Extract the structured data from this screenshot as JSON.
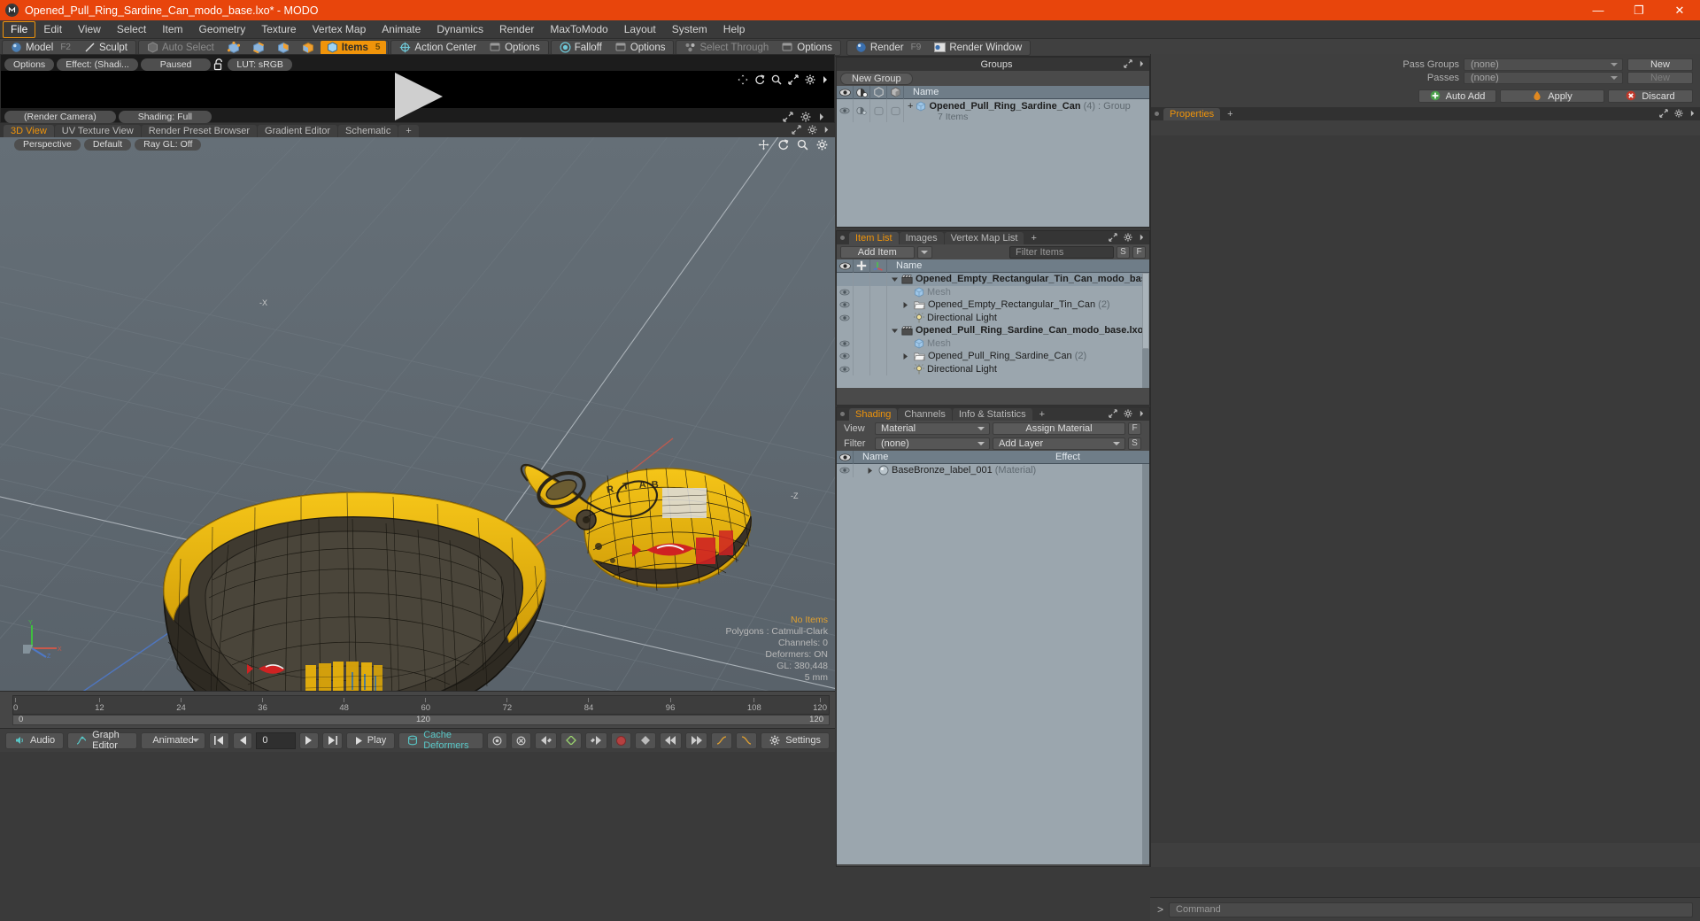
{
  "window": {
    "title": "Opened_Pull_Ring_Sardine_Can_modo_base.lxo* - MODO",
    "logo_glyph": "M",
    "minimize": "—",
    "maximize": "❐",
    "close": "✕",
    "titlebar_color": "#e8450c"
  },
  "menu": {
    "items": [
      {
        "label": "File",
        "active": true
      },
      {
        "label": "Edit",
        "active": false
      },
      {
        "label": "View",
        "active": false
      },
      {
        "label": "Select",
        "active": false
      },
      {
        "label": "Item",
        "active": false
      },
      {
        "label": "Geometry",
        "active": false
      },
      {
        "label": "Texture",
        "active": false
      },
      {
        "label": "Vertex Map",
        "active": false
      },
      {
        "label": "Animate",
        "active": false
      },
      {
        "label": "Dynamics",
        "active": false
      },
      {
        "label": "Render",
        "active": false
      },
      {
        "label": "MaxToModo",
        "active": false
      },
      {
        "label": "Layout",
        "active": false
      },
      {
        "label": "System",
        "active": false
      },
      {
        "label": "Help",
        "active": false
      }
    ]
  },
  "toolbar": {
    "model": "Model",
    "model_key": "F2",
    "sculpt": "Sculpt",
    "auto_select": "Auto Select",
    "items": "Items",
    "items_key": "5",
    "action_center": "Action Center",
    "options_1": "Options",
    "falloff": "Falloff",
    "options_2": "Options",
    "select_through": "Select Through",
    "options_3": "Options",
    "render": "Render",
    "render_key": "F9",
    "render_window": "Render Window",
    "accent": "#f0940a"
  },
  "preview": {
    "options": "Options",
    "effect": "Effect: (Shadi...",
    "paused": "Paused",
    "lock_icon": "unlock-icon",
    "lut": "LUT: sRGB",
    "render_camera": "(Render Camera)",
    "shading": "Shading: Full"
  },
  "viewport_tabs": {
    "tabs": [
      {
        "label": "3D View",
        "active": true
      },
      {
        "label": "UV Texture View",
        "active": false
      },
      {
        "label": "Render Preset Browser",
        "active": false
      },
      {
        "label": "Gradient Editor",
        "active": false
      },
      {
        "label": "Schematic",
        "active": false
      },
      {
        "label": "+",
        "active": false
      }
    ]
  },
  "viewport": {
    "perspective": "Perspective",
    "default": "Default",
    "ray_gl": "Ray GL: Off",
    "stats": {
      "no_items": "No Items",
      "polygons": "Polygons : Catmull-Clark",
      "channels": "Channels: 0",
      "deformers": "Deformers: ON",
      "gl": "GL: 380,448",
      "scale": "5 mm"
    },
    "axis": {
      "x": "X",
      "y": "Y",
      "z": "Z"
    }
  },
  "timeline": {
    "ticks": [
      "0",
      "12",
      "24",
      "36",
      "48",
      "60",
      "72",
      "84",
      "96",
      "108",
      "120"
    ],
    "range_label": "120",
    "end_label": "120",
    "start_label": "0"
  },
  "bottombar": {
    "audio": "Audio",
    "graph_editor": "Graph Editor",
    "animated": "Animated",
    "frame_value": "0",
    "play": "Play",
    "cache_deformers": "Cache Deformers",
    "settings": "Settings"
  },
  "groups_panel": {
    "tab_title": "Groups",
    "new_group_button": "New Group",
    "columns": [
      "eye-column",
      "shade-column",
      "box-column",
      "box2-column",
      "Name"
    ],
    "name_header": "Name",
    "rows": [
      {
        "name": "Opened_Pull_Ring_Sardine_Can",
        "count": "(4)",
        "type": ": Group",
        "sub": "7 Items"
      }
    ]
  },
  "item_list_panel": {
    "tabs": [
      {
        "label": "Item List",
        "active": true
      },
      {
        "label": "Images",
        "active": false
      },
      {
        "label": "Vertex Map List",
        "active": false
      },
      {
        "label": "+",
        "active": false
      }
    ],
    "add_item": "Add Item",
    "filter_placeholder": "Filter Items",
    "btn_s": "S",
    "btn_f": "F",
    "name_header": "Name",
    "rows": [
      {
        "label": "Opened_Empty_Rectangular_Tin_Can_modo_base.lxo*",
        "count": "",
        "indent": 0,
        "icon": "scene-icon",
        "style": "bold",
        "expander": "down",
        "selected": true
      },
      {
        "label": "Mesh",
        "count": "",
        "indent": 1,
        "icon": "mesh-icon",
        "style": "muted",
        "expander": "none",
        "selected": false
      },
      {
        "label": "Opened_Empty_Rectangular_Tin_Can",
        "count": "(2)",
        "indent": 1,
        "icon": "folder-icon",
        "style": "normal",
        "expander": "right",
        "selected": false
      },
      {
        "label": "Directional Light",
        "count": "",
        "indent": 1,
        "icon": "light-icon",
        "style": "normal",
        "expander": "none",
        "selected": false
      },
      {
        "label": "Opened_Pull_Ring_Sardine_Can_modo_base.lxo*",
        "count": "",
        "indent": 0,
        "icon": "scene-icon",
        "style": "bold",
        "expander": "down",
        "selected": false
      },
      {
        "label": "Mesh",
        "count": "",
        "indent": 1,
        "icon": "mesh-icon",
        "style": "muted",
        "expander": "none",
        "selected": false
      },
      {
        "label": "Opened_Pull_Ring_Sardine_Can",
        "count": "(2)",
        "indent": 1,
        "icon": "folder-icon",
        "style": "normal",
        "expander": "right",
        "selected": false
      },
      {
        "label": "Directional Light",
        "count": "",
        "indent": 1,
        "icon": "light-icon",
        "style": "normal",
        "expander": "none",
        "selected": false
      }
    ]
  },
  "shading_panel": {
    "tabs": [
      {
        "label": "Shading",
        "active": true
      },
      {
        "label": "Channels",
        "active": false
      },
      {
        "label": "Info & Statistics",
        "active": false
      },
      {
        "label": "+",
        "active": false
      }
    ],
    "view_label": "View",
    "view_value": "Material",
    "assign_material": "Assign Material",
    "btn_f": "F",
    "filter_label": "Filter",
    "filter_value": "(none)",
    "add_layer": "Add Layer",
    "btn_s": "S",
    "name_header": "Name",
    "effect_header": "Effect",
    "rows": [
      {
        "name": "BaseBronze_label_001",
        "type": "(Material)",
        "effect": ""
      }
    ]
  },
  "right_column": {
    "pass_groups_label": "Pass Groups",
    "pass_groups_value": "(none)",
    "new_button_1": "New",
    "passes_label": "Passes",
    "passes_value": "(none)",
    "new_button_2": "New",
    "auto_add": "Auto Add",
    "apply": "Apply",
    "discard": "Discard",
    "properties_tab": "Properties",
    "plus_tab": "+"
  },
  "command_bar": {
    "prompt": ">",
    "placeholder": "Command"
  }
}
